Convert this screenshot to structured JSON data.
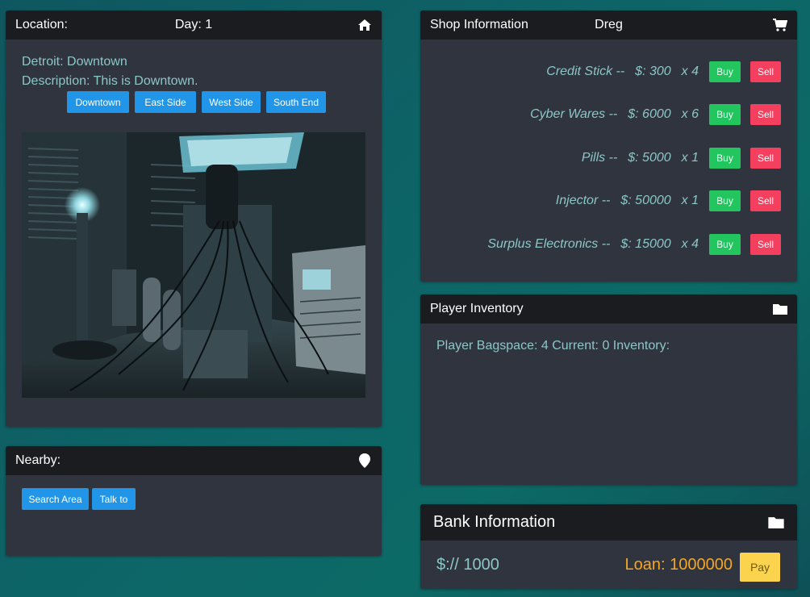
{
  "location_panel": {
    "header_label": "Location:",
    "day_label": "Day: 1",
    "header_icon": "home-icon",
    "location_text": "Detroit: Downtown",
    "description_text": "Description: This is Downtown.",
    "area_buttons": [
      "Downtown",
      "East Side",
      "West Side",
      "South End"
    ],
    "image_alt": "cyberpunk lab scene"
  },
  "nearby_panel": {
    "header_label": "Nearby:",
    "header_icon": "map-pin-icon",
    "buttons": [
      "Search Area",
      "Talk to"
    ]
  },
  "shop_panel": {
    "header_label": "Shop Information",
    "shopkeeper": "Dreg",
    "header_icon": "shopping-cart-icon",
    "buy_label": "Buy",
    "sell_label": "Sell",
    "items": [
      {
        "name": "Credit Stick --",
        "price": "$: 300",
        "qty": "x 4"
      },
      {
        "name": "Cyber Wares --",
        "price": "$: 6000",
        "qty": "x 6"
      },
      {
        "name": "Pills --",
        "price": "$: 5000",
        "qty": "x 1"
      },
      {
        "name": "Injector --",
        "price": "$: 50000",
        "qty": "x 1"
      },
      {
        "name": "Surplus Electronics --",
        "price": "$: 15000",
        "qty": "x 4"
      }
    ]
  },
  "inventory_panel": {
    "header_label": "Player Inventory",
    "header_icon": "folder-icon",
    "status_text": "Player Bagspace: 4 Current: 0 Inventory:"
  },
  "bank_panel": {
    "header_label": "Bank Information",
    "header_icon": "folder-icon",
    "balance": "$:// 1000",
    "loan": "Loan: 1000000",
    "pay_label": "Pay"
  },
  "colors": {
    "text_teal": "#8cc7c8",
    "loan_orange": "#f5a623",
    "blue": "#2196e8",
    "green": "#22c55e",
    "red": "#f43f5e",
    "yellow": "#fcd34d"
  }
}
